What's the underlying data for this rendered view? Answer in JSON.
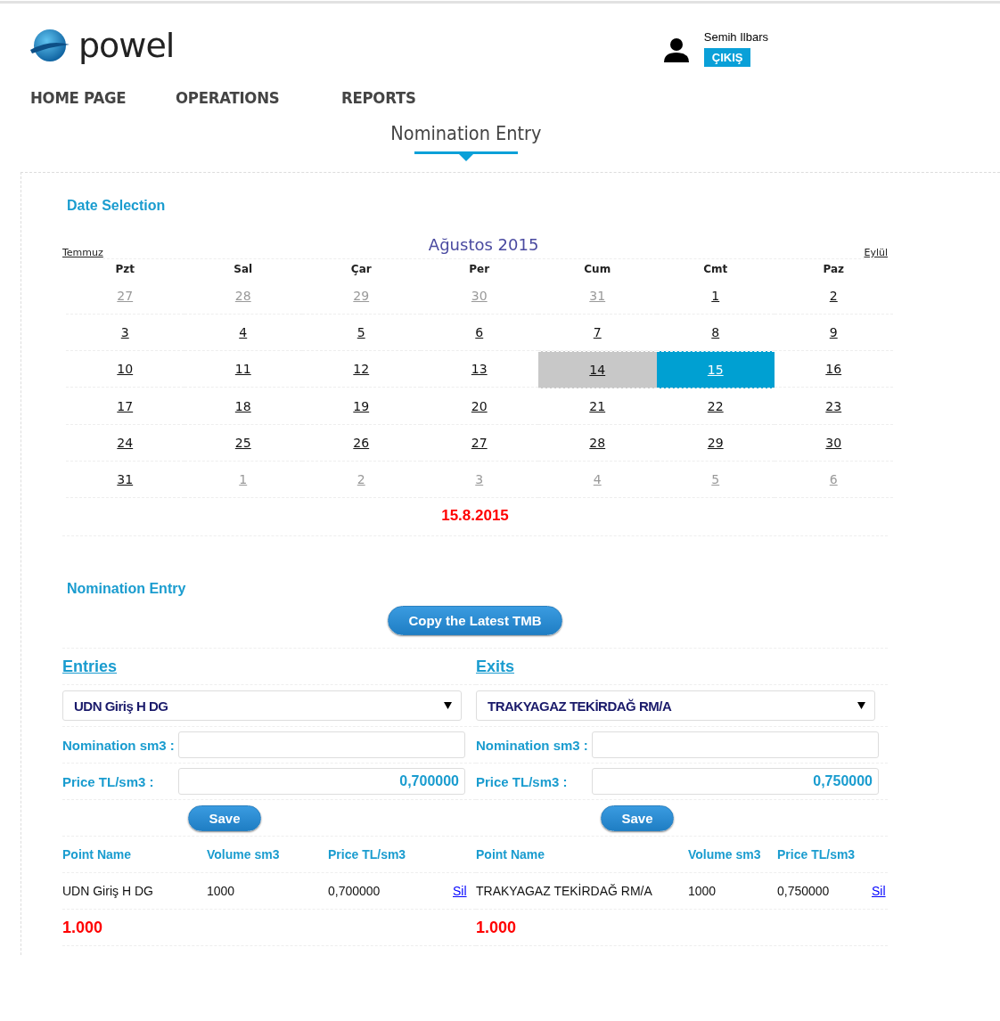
{
  "header": {
    "logo_text": "powel",
    "user_name": "Semih Ilbars",
    "logout_button": "ÇIKIŞ"
  },
  "nav": [
    {
      "label": "HOME PAGE"
    },
    {
      "label": "OPERATIONS"
    },
    {
      "label": "REPORTS"
    }
  ],
  "page_title": "Nomination Entry",
  "date_selection": {
    "heading": "Date Selection",
    "prev_month": "Temmuz",
    "month_title": "Ağustos 2015",
    "next_month": "Eylül",
    "weekdays": [
      "Pzt",
      "Sal",
      "Çar",
      "Per",
      "Cum",
      "Cmt",
      "Paz"
    ],
    "days": [
      {
        "label": "27",
        "other_month": true,
        "today": false,
        "selected": false
      },
      {
        "label": "28",
        "other_month": true,
        "today": false,
        "selected": false
      },
      {
        "label": "29",
        "other_month": true,
        "today": false,
        "selected": false
      },
      {
        "label": "30",
        "other_month": true,
        "today": false,
        "selected": false
      },
      {
        "label": "31",
        "other_month": true,
        "today": false,
        "selected": false
      },
      {
        "label": "1",
        "other_month": false,
        "today": false,
        "selected": false
      },
      {
        "label": "2",
        "other_month": false,
        "today": false,
        "selected": false
      },
      {
        "label": "3",
        "other_month": false,
        "today": false,
        "selected": false
      },
      {
        "label": "4",
        "other_month": false,
        "today": false,
        "selected": false
      },
      {
        "label": "5",
        "other_month": false,
        "today": false,
        "selected": false
      },
      {
        "label": "6",
        "other_month": false,
        "today": false,
        "selected": false
      },
      {
        "label": "7",
        "other_month": false,
        "today": false,
        "selected": false
      },
      {
        "label": "8",
        "other_month": false,
        "today": false,
        "selected": false
      },
      {
        "label": "9",
        "other_month": false,
        "today": false,
        "selected": false
      },
      {
        "label": "10",
        "other_month": false,
        "today": false,
        "selected": false
      },
      {
        "label": "11",
        "other_month": false,
        "today": false,
        "selected": false
      },
      {
        "label": "12",
        "other_month": false,
        "today": false,
        "selected": false
      },
      {
        "label": "13",
        "other_month": false,
        "today": false,
        "selected": false
      },
      {
        "label": "14",
        "other_month": false,
        "today": true,
        "selected": false
      },
      {
        "label": "15",
        "other_month": false,
        "today": false,
        "selected": true
      },
      {
        "label": "16",
        "other_month": false,
        "today": false,
        "selected": false
      },
      {
        "label": "17",
        "other_month": false,
        "today": false,
        "selected": false
      },
      {
        "label": "18",
        "other_month": false,
        "today": false,
        "selected": false
      },
      {
        "label": "19",
        "other_month": false,
        "today": false,
        "selected": false
      },
      {
        "label": "20",
        "other_month": false,
        "today": false,
        "selected": false
      },
      {
        "label": "21",
        "other_month": false,
        "today": false,
        "selected": false
      },
      {
        "label": "22",
        "other_month": false,
        "today": false,
        "selected": false
      },
      {
        "label": "23",
        "other_month": false,
        "today": false,
        "selected": false
      },
      {
        "label": "24",
        "other_month": false,
        "today": false,
        "selected": false
      },
      {
        "label": "25",
        "other_month": false,
        "today": false,
        "selected": false
      },
      {
        "label": "26",
        "other_month": false,
        "today": false,
        "selected": false
      },
      {
        "label": "27",
        "other_month": false,
        "today": false,
        "selected": false
      },
      {
        "label": "28",
        "other_month": false,
        "today": false,
        "selected": false
      },
      {
        "label": "29",
        "other_month": false,
        "today": false,
        "selected": false
      },
      {
        "label": "30",
        "other_month": false,
        "today": false,
        "selected": false
      },
      {
        "label": "31",
        "other_month": false,
        "today": false,
        "selected": false
      },
      {
        "label": "1",
        "other_month": true,
        "today": false,
        "selected": false
      },
      {
        "label": "2",
        "other_month": true,
        "today": false,
        "selected": false
      },
      {
        "label": "3",
        "other_month": true,
        "today": false,
        "selected": false
      },
      {
        "label": "4",
        "other_month": true,
        "today": false,
        "selected": false
      },
      {
        "label": "5",
        "other_month": true,
        "today": false,
        "selected": false
      },
      {
        "label": "6",
        "other_month": true,
        "today": false,
        "selected": false
      }
    ],
    "selected_date": "15.8.2015"
  },
  "nomination": {
    "heading": "Nomination Entry",
    "copy_button": "Copy the Latest TMB",
    "panels": [
      {
        "title": "Entries",
        "point": "UDN Giriş H DG",
        "nomination_label": "Nomination sm3 :",
        "price_label": "Price TL/sm3 :",
        "price_value": "0,700000",
        "save_button": "Save",
        "columns": [
          "Point Name",
          "Volume sm3",
          "Price TL/sm3"
        ],
        "rows": [
          {
            "point_name": "UDN Giriş H DG",
            "volume": "1000",
            "price": "0,700000",
            "delete_link": "Sil"
          }
        ],
        "total": "1.000"
      },
      {
        "title": "Exits",
        "point": "TRAKYAGAZ TEKİRDAĞ RM/A",
        "nomination_label": "Nomination sm3 :",
        "price_label": "Price TL/sm3 :",
        "price_value": "0,750000",
        "save_button": "Save",
        "columns": [
          "Point Name",
          "Volume sm3",
          "Price TL/sm3"
        ],
        "rows": [
          {
            "point_name": "TRAKYAGAZ TEKİRDAĞ RM/A",
            "volume": "1000",
            "price": "0,750000",
            "delete_link": "Sil"
          }
        ],
        "total": "1.000"
      }
    ]
  }
}
